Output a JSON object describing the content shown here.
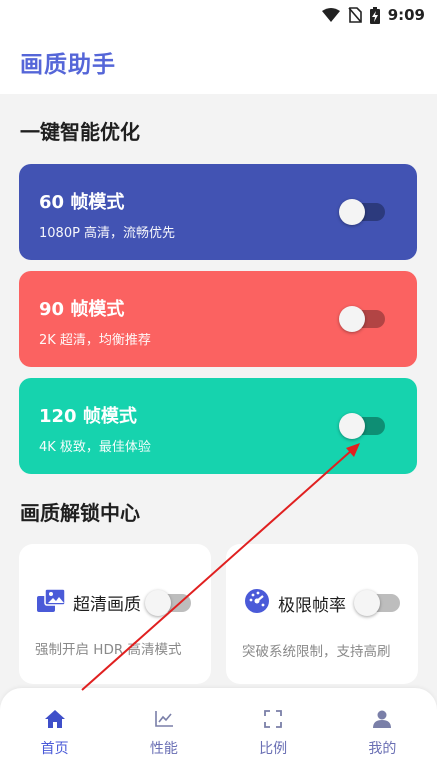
{
  "status_bar": {
    "time": "9:09",
    "icons": [
      "wifi-icon",
      "no-sim-icon",
      "battery-charging-icon"
    ]
  },
  "app": {
    "title": "画质助手"
  },
  "sections": {
    "optimize_title": "一键智能优化",
    "unlock_title": "画质解锁中心"
  },
  "modes": [
    {
      "title": "60 帧模式",
      "desc": "1080P 高清，流畅优先",
      "color": "#4253b3",
      "enabled": false
    },
    {
      "title": "90 帧模式",
      "desc": "2K 超清，均衡推荐",
      "color": "#fb6261",
      "enabled": false
    },
    {
      "title": "120 帧模式",
      "desc": "4K 极致，最佳体验",
      "color": "#16d3ae",
      "enabled": false
    }
  ],
  "unlock": [
    {
      "label": "超清画质",
      "desc": "强制开启 HDR 高清模式",
      "icon": "image-stack-icon",
      "enabled": false
    },
    {
      "label": "极限帧率",
      "desc": "突破系统限制，支持高刷",
      "icon": "speedometer-icon",
      "enabled": false
    }
  ],
  "nav": [
    {
      "label": "首页",
      "icon": "home-icon",
      "active": true
    },
    {
      "label": "性能",
      "icon": "chart-icon",
      "active": false
    },
    {
      "label": "比例",
      "icon": "fullscreen-icon",
      "active": false
    },
    {
      "label": "我的",
      "icon": "person-icon",
      "active": false
    }
  ],
  "colors": {
    "accent": "#5566d8",
    "annotation_arrow": "#e02020"
  }
}
